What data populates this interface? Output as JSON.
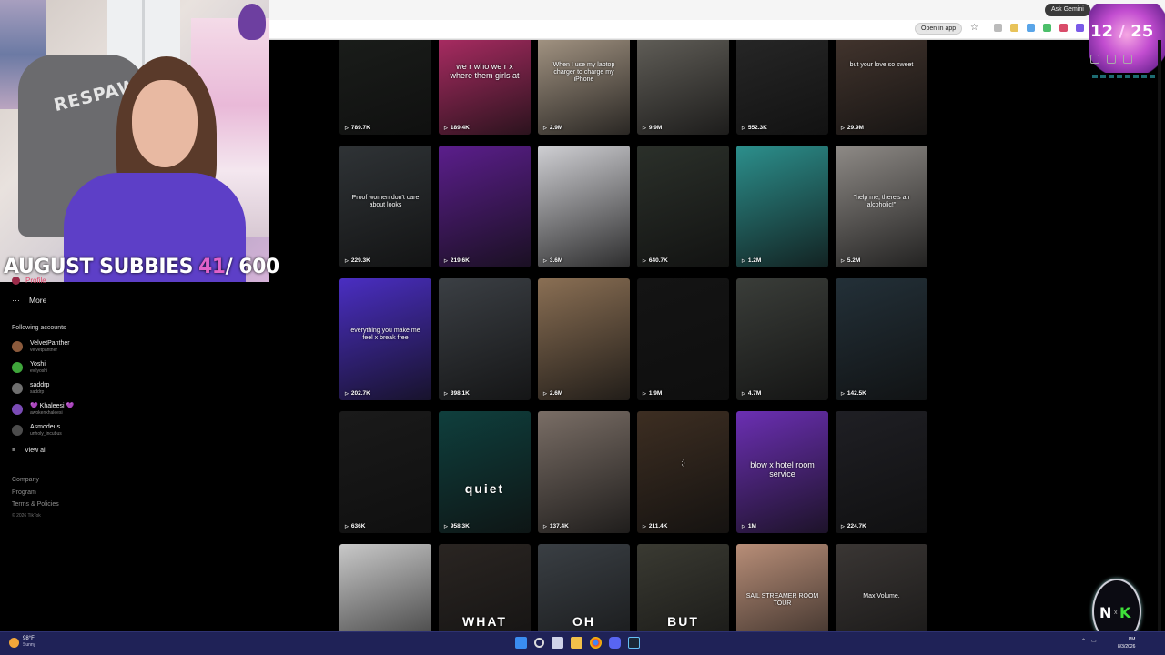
{
  "browser": {
    "ask_gemini": "Ask Gemini",
    "open_in_app": "Open in app",
    "star_icon": "star-icon"
  },
  "stream": {
    "subgoal_label": "AUGUST SUBBIES",
    "subgoal_count": "41",
    "subgoal_goal": "/ 600",
    "webcam_brand": "RESPAWN",
    "timer_left": "12",
    "timer_sep": "/",
    "timer_right": "25",
    "corner_logo_left": "N",
    "corner_logo_x": "x",
    "corner_logo_right": "K"
  },
  "nav": {
    "profile": "Profile",
    "more": "More",
    "more_icon": "ellipsis-icon",
    "following_title": "Following accounts",
    "accounts": [
      {
        "name": "VelvetPanther",
        "handle": "velvetpanther",
        "color": "#8b5a3c"
      },
      {
        "name": "Yoshi",
        "handle": "evilyoshi",
        "color": "#3fa63b"
      },
      {
        "name": "saddrp",
        "handle": "saddrp",
        "color": "#6f6f6f"
      },
      {
        "name": "💜 Khaleesi 💜",
        "handle": "awokenkhaleesi",
        "color": "#7a4bb5"
      },
      {
        "name": "Asmodeus",
        "handle": "unholy_incubus",
        "color": "#4c4c4c"
      }
    ],
    "view_all": "View all",
    "footer": {
      "company": "Company",
      "program": "Program",
      "terms": "Terms & Policies",
      "copyright": "© 2026 TikTok"
    }
  },
  "videos": [
    {
      "caption": "",
      "views": "789.7K",
      "bg": "#1c1f1c"
    },
    {
      "caption": "we r who we r x where them girls at",
      "views": "189.4K",
      "bg": "#c1306f"
    },
    {
      "caption": "When I use my laptop charger to charge my iPhone",
      "views": "2.9M",
      "bg": "#b9a894"
    },
    {
      "caption": "",
      "views": "9.9M",
      "bg": "#6d6a63"
    },
    {
      "caption": "",
      "views": "552.3K",
      "bg": "#2a2a2a"
    },
    {
      "caption": "but your love so sweet",
      "views": "29.9M",
      "bg": "#4a3a32"
    },
    {
      "caption": "Proof women don't care about looks",
      "views": "229.3K",
      "bg": "#2f3336"
    },
    {
      "caption": "",
      "views": "219.6K",
      "bg": "#5b1e8c"
    },
    {
      "caption": "",
      "views": "3.6M",
      "bg": "#cfcfd3"
    },
    {
      "caption": "",
      "views": "640.7K",
      "bg": "#2b302a"
    },
    {
      "caption": "",
      "views": "1.2M",
      "bg": "#2c8f8c"
    },
    {
      "caption": "\"help me, there's an alcoholic!\"",
      "views": "5.2M",
      "bg": "#8e8a86"
    },
    {
      "caption": "everything you make me feel x break free",
      "views": "202.7K",
      "bg": "#4a2ec2"
    },
    {
      "caption": "",
      "views": "398.1K",
      "bg": "#3b3f44"
    },
    {
      "caption": "",
      "views": "2.6M",
      "bg": "#8a6f54"
    },
    {
      "caption": "",
      "views": "1.9M",
      "bg": "#141414"
    },
    {
      "caption": "",
      "views": "4.7M",
      "bg": "#3a3d39"
    },
    {
      "caption": "",
      "views": "142.5K",
      "bg": "#233038"
    },
    {
      "caption": "",
      "views": "636K",
      "bg": "#1a1a1a"
    },
    {
      "caption": "quiet",
      "views": "958.3K",
      "bg": "#0f3f3d"
    },
    {
      "caption": "",
      "views": "137.4K",
      "bg": "#7a6e66"
    },
    {
      "caption": ";)",
      "views": "211.4K",
      "bg": "#3d2e22"
    },
    {
      "caption": "blow x hotel room service",
      "views": "1M",
      "bg": "#6b2fb3"
    },
    {
      "caption": "",
      "views": "224.7K",
      "bg": "#1f1f24"
    },
    {
      "caption": "",
      "views": "",
      "bg": "#c9c9c9"
    },
    {
      "caption": "WHAT",
      "views": "",
      "bg": "#2a2522"
    },
    {
      "caption": "OH",
      "views": "",
      "bg": "#3a3f44"
    },
    {
      "caption": "BUT",
      "views": "",
      "bg": "#3a3a32"
    },
    {
      "caption": "SAIL STREAMER ROOM TOUR",
      "views": "",
      "bg": "#b88e78"
    },
    {
      "caption": "Max Volume.",
      "views": "",
      "bg": "#3a3634"
    }
  ],
  "taskbar": {
    "temp": "98°F",
    "condition": "Sunny",
    "clock_time": "PM",
    "clock_date": "8/3/2026"
  }
}
